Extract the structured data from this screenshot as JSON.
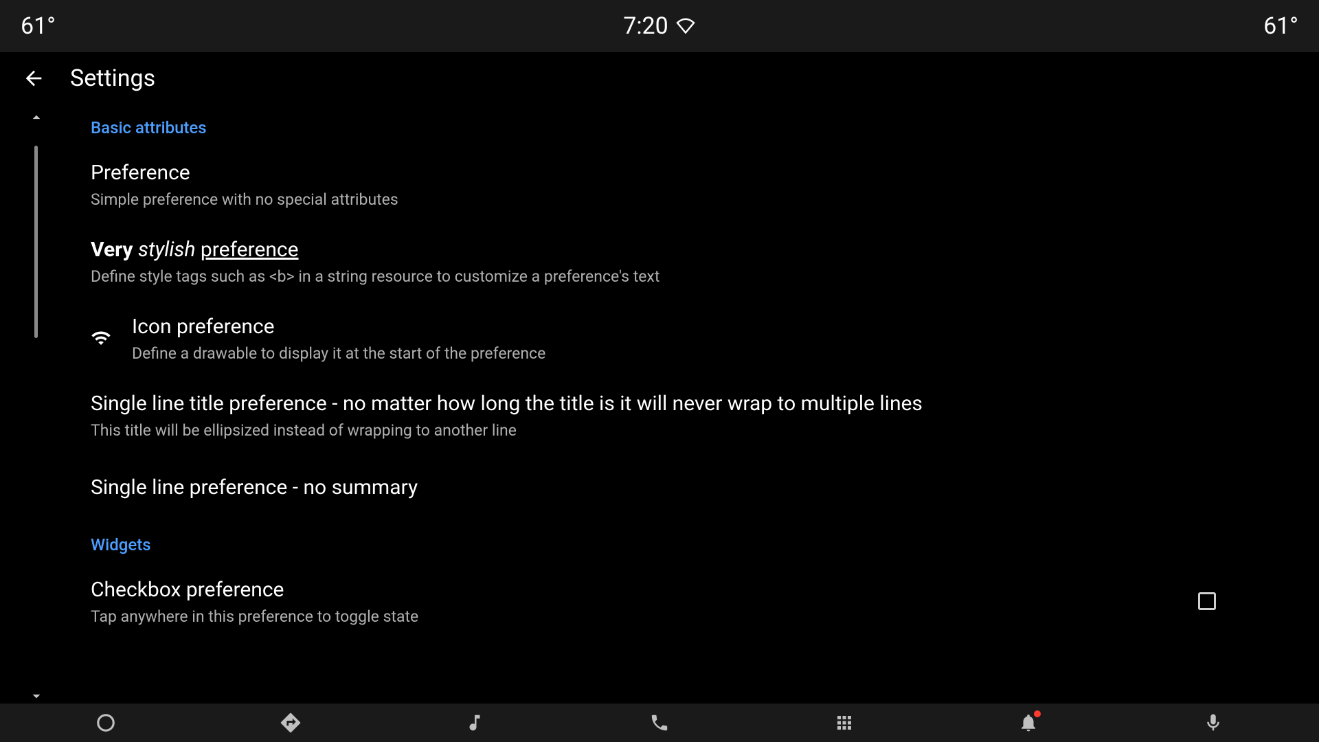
{
  "status": {
    "left_temp": "61°",
    "time": "7:20",
    "right_temp": "61°"
  },
  "header": {
    "title": "Settings"
  },
  "sections": {
    "basic": {
      "label": "Basic attributes",
      "items": {
        "pref": {
          "title": "Preference",
          "summary": "Simple preference with no special attributes"
        },
        "stylish": {
          "title_bold": "Very",
          "title_italic": "stylish",
          "title_underline": "preference",
          "summary": "Define style tags such as <b> in a string resource to customize a preference's text"
        },
        "icon": {
          "title": "Icon preference",
          "summary": "Define a drawable to display it at the start of the preference"
        },
        "singleline": {
          "title": "Single line title preference - no matter how long the title is it will never wrap to multiple lines",
          "summary": "This title will be ellipsized instead of wrapping to another line"
        },
        "nosummary": {
          "title": "Single line preference - no summary"
        }
      }
    },
    "widgets": {
      "label": "Widgets",
      "items": {
        "checkbox": {
          "title": "Checkbox preference",
          "summary": "Tap anywhere in this preference to toggle state",
          "checked": false
        }
      }
    }
  }
}
